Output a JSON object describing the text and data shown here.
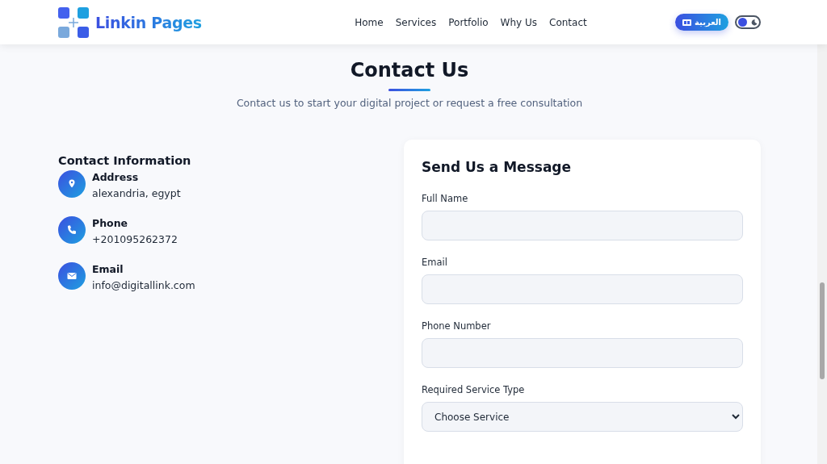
{
  "header": {
    "logo_text": "Linkin Pages",
    "nav": [
      {
        "label": "Home",
        "selected": false
      },
      {
        "label": "Services",
        "selected": false
      },
      {
        "label": "Portfolio",
        "selected": false
      },
      {
        "label": "Why Us",
        "selected": false
      },
      {
        "label": "Contact",
        "selected": false
      }
    ],
    "language_button": "العربية",
    "dark_mode": {
      "on": false
    }
  },
  "section": {
    "title": "Contact Us",
    "subtitle": "Contact us to start your digital project or request a free consultation"
  },
  "contact_info": {
    "heading": "Contact Information",
    "items": [
      {
        "kind": "address",
        "label": "Address",
        "value": "alexandria, egypt"
      },
      {
        "kind": "phone",
        "label": "Phone",
        "value": "+201095262372"
      },
      {
        "kind": "email",
        "label": "Email",
        "value": "info@digitallink.com"
      }
    ]
  },
  "form": {
    "title": "Send Us a Message",
    "fields": [
      {
        "kind": "text",
        "label": "Full Name"
      },
      {
        "kind": "text",
        "label": "Email"
      },
      {
        "kind": "text",
        "label": "Phone Number"
      },
      {
        "kind": "select",
        "label": "Required Service Type",
        "value": "Choose Service"
      }
    ]
  }
}
